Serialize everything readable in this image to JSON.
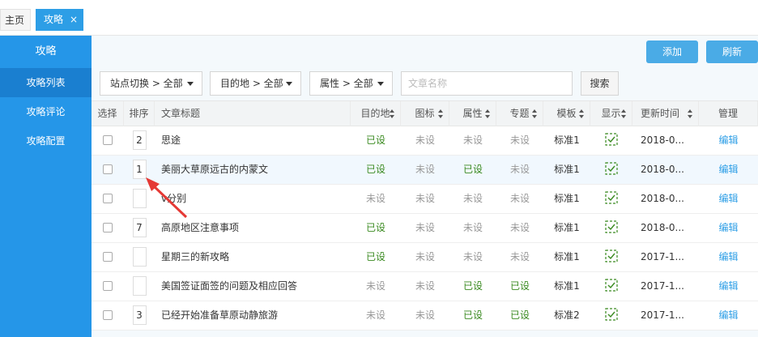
{
  "tabs": {
    "home": "主页",
    "active": "攻略",
    "close": "×"
  },
  "sidebar": {
    "title": "攻略",
    "items": [
      {
        "label": "攻略列表",
        "active": true
      },
      {
        "label": "攻略评论",
        "active": false
      },
      {
        "label": "攻略配置",
        "active": false
      }
    ]
  },
  "toolbar": {
    "add_label": "添加",
    "refresh_label": "刷新"
  },
  "filters": {
    "site": "站点切换 > 全部",
    "destination": "目的地 > 全部",
    "attribute": "属性 > 全部",
    "search_placeholder": "文章名称",
    "search_value": "",
    "search_label": "搜索"
  },
  "table": {
    "headers": {
      "select": "选择",
      "order": "排序",
      "title": "文章标题",
      "destination": "目的地",
      "icon": "图标",
      "attribute": "属性",
      "topic": "专题",
      "template": "模板",
      "show": "显示",
      "updated": "更新时间",
      "manage": "管理"
    },
    "rows": [
      {
        "order": "2",
        "title": "思途",
        "destination": "已设",
        "icon": "未设",
        "attribute": "未设",
        "topic": "未设",
        "template": "标准1",
        "updated": "2018-0...",
        "manage": "编辑"
      },
      {
        "order": "1",
        "title": "美丽大草原远古的内蒙文",
        "destination": "已设",
        "icon": "未设",
        "attribute": "已设",
        "topic": "未设",
        "template": "标准1",
        "updated": "2018-0...",
        "manage": "编辑"
      },
      {
        "order": "",
        "title": "v分别",
        "destination": "未设",
        "icon": "未设",
        "attribute": "未设",
        "topic": "未设",
        "template": "标准1",
        "updated": "2018-0...",
        "manage": "编辑"
      },
      {
        "order": "7",
        "title": "高原地区注意事项",
        "destination": "已设",
        "icon": "未设",
        "attribute": "未设",
        "topic": "未设",
        "template": "标准1",
        "updated": "2018-0...",
        "manage": "编辑"
      },
      {
        "order": "",
        "title": "星期三的新攻略",
        "destination": "已设",
        "icon": "未设",
        "attribute": "未设",
        "topic": "未设",
        "template": "标准1",
        "updated": "2017-1...",
        "manage": "编辑"
      },
      {
        "order": "",
        "title": "美国签证面签的问题及相应回答",
        "destination": "未设",
        "icon": "未设",
        "attribute": "已设",
        "topic": "已设",
        "template": "标准1",
        "updated": "2017-1...",
        "manage": "编辑"
      },
      {
        "order": "3",
        "title": "已经开始准备草原动静旅游",
        "destination": "未设",
        "icon": "未设",
        "attribute": "已设",
        "topic": "已设",
        "template": "标准2",
        "updated": "2017-1...",
        "manage": "编辑"
      }
    ]
  },
  "colors": {
    "accent": "#2596e8",
    "set": "#3a8a20",
    "unset": "#999999",
    "link": "#2d9ee6",
    "annotation": "#e53935"
  }
}
